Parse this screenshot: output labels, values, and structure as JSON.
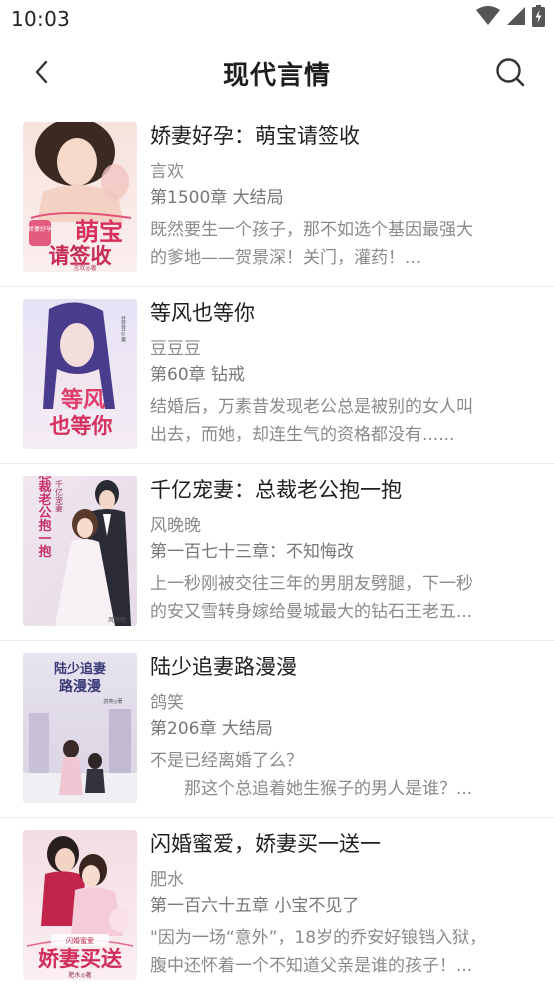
{
  "status_bar": {
    "time": "10:03"
  },
  "header": {
    "title": "现代言情"
  },
  "books": [
    {
      "title": "娇妻好孕：萌宝请签收",
      "author": "言欢",
      "chapter": "第1500章 大结局",
      "desc_lines": [
        "既然要生一个孩子，那不如选个基因最强大",
        "的爹地——贺景深！关门，灌药！..."
      ],
      "cover_text": {
        "main": "萌宝",
        "main2": "请签收",
        "badge": "娇妻好孕",
        "by": "言欢◎著"
      }
    },
    {
      "title": "等风也等你",
      "author": "豆豆豆",
      "chapter": "第60章 钻戒",
      "desc_lines": [
        "结婚后，万素昔发现老公总是被别的女人叫",
        "出去，而她，却连生气的资格都没有......"
      ],
      "cover_text": {
        "main": "等风",
        "main2": "也等你",
        "by": "豆豆豆◎著"
      }
    },
    {
      "title": "千亿宠妻：总裁老公抱一抱",
      "author": "风晚晚",
      "chapter": "第一百七十三章：不知悔改",
      "desc_lines": [
        "上一秒刚被交往三年的男朋友劈腿，下一秒",
        "的安又雪转身嫁给曼城最大的钻石王老五..."
      ],
      "cover_text": {
        "main": "千亿宠妻",
        "main2": "总裁老公抱一抱",
        "by": "风晚晚"
      }
    },
    {
      "title": "陆少追妻路漫漫",
      "author": "鸽笑",
      "chapter": "第206章 大结局",
      "desc_lines": [
        "不是已经离婚了么？",
        "　　那这个总追着她生猴子的男人是谁？..."
      ],
      "cover_text": {
        "main": "陆少追妻",
        "main2": "路漫漫",
        "by": "鸽笑◎著"
      }
    },
    {
      "title": "闪婚蜜爱，娇妻买一送一",
      "author": "肥水",
      "chapter": "第一百六十五章 小宝不见了",
      "desc_lines": [
        "\"因为一场“意外”，18岁的乔安好锒铛入狱，",
        "腹中还怀着一个不知道父亲是谁的孩子！..."
      ],
      "cover_text": {
        "main": "娇妻买送",
        "badge": "闪婚蜜爱",
        "by": "肥水◎著"
      }
    }
  ],
  "colors": {
    "accent": "#e8326b",
    "text": "#1e1e1e",
    "muted": "#8a8a8a"
  },
  "icons": {
    "back": "chevron-left-icon",
    "search": "search-icon",
    "wifi": "wifi-icon",
    "signal": "signal-icon",
    "battery": "battery-icon"
  }
}
